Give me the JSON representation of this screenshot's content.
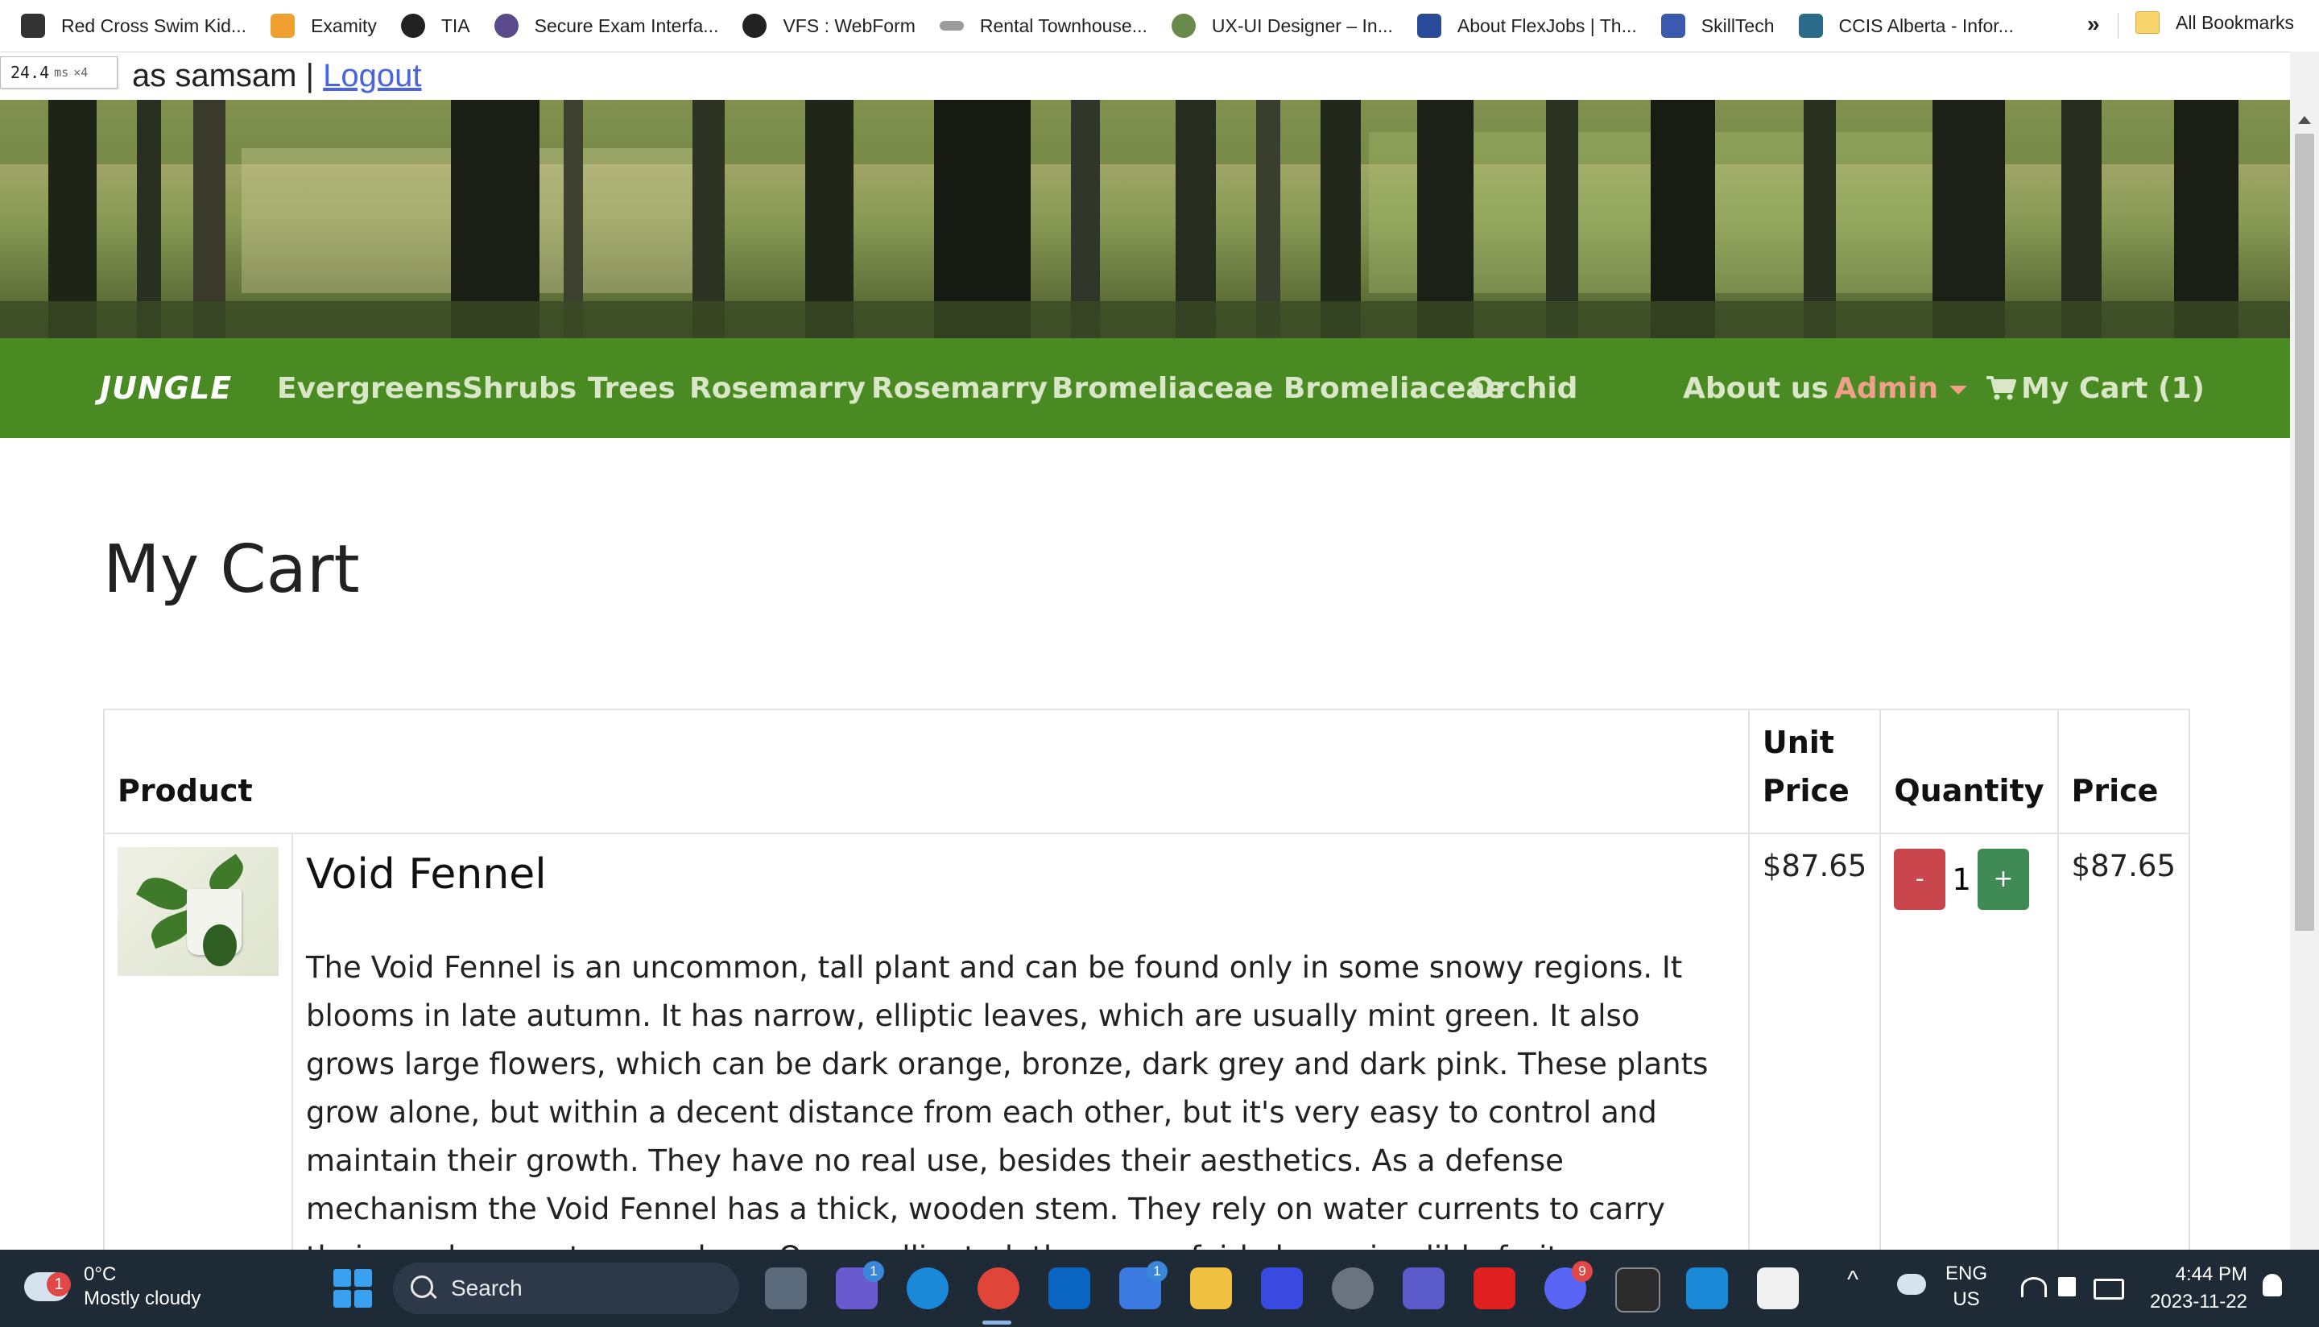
{
  "bookmarks": {
    "items": [
      {
        "label": "Red Cross Swim Kid...",
        "color": "#333333"
      },
      {
        "label": "Examity",
        "color": "#f0a030"
      },
      {
        "label": "TIA",
        "color": "#222222"
      },
      {
        "label": "Secure Exam Interfa...",
        "color": "#5a4a8a"
      },
      {
        "label": "VFS : WebForm",
        "color": "#222222"
      },
      {
        "label": "Rental Townhouse...",
        "color": "#9a9a9a"
      },
      {
        "label": "UX-UI Designer – In...",
        "color": "#6a8a4a"
      },
      {
        "label": "About FlexJobs | Th...",
        "color": "#2a4a9a"
      },
      {
        "label": "SkillTech",
        "color": "#3a5ab0"
      },
      {
        "label": "CCIS Alberta - Infor...",
        "color": "#2a6a8a"
      }
    ],
    "more": "»",
    "all": "All Bookmarks"
  },
  "perf": {
    "value": "24.4",
    "unit": "ms",
    "mult": "×4"
  },
  "login": {
    "text": "as samsam",
    "separator": "|",
    "logout": "Logout"
  },
  "navbar": {
    "brand": "JUNGLE",
    "links": [
      "Evergreens",
      "Shrubs",
      "Trees",
      "Rosemarry",
      "Rosemarry",
      "Bromeliaceae Bromeliaceae",
      "Orchid"
    ],
    "about": "About us",
    "admin": "Admin",
    "cart": "My Cart (1)",
    "bg_color": "#4a8a22",
    "admin_color": "#f0a08a"
  },
  "page": {
    "title": "My Cart"
  },
  "table": {
    "headers": {
      "product": "Product",
      "unit_price": "Unit Price",
      "quantity": "Quantity",
      "price": "Price"
    },
    "rows": [
      {
        "name": "Void Fennel",
        "description": "The Void Fennel is an uncommon, tall plant and can be found only in some snowy regions. It blooms in late autumn. It has narrow, elliptic leaves, which are usually mint green. It also grows large flowers, which can be dark orange, bronze, dark grey and dark pink. These plants grow alone, but within a decent distance from each other, but it's very easy to control and maintain their growth. They have no real use, besides their aesthetics. As a defense mechanism the Void Fennel has a thick, wooden stem. They rely on water currents to carry their seeds away to reproduce. Once pollinated, they grow fairly large, inedible fruits.",
        "unit_price": "$87.65",
        "quantity": "1",
        "price": "$87.65",
        "minus": "-",
        "plus": "+"
      }
    ]
  },
  "taskbar": {
    "weather": {
      "temp": "0°C",
      "condition": "Mostly cloudy",
      "badge": "1"
    },
    "search": "Search",
    "badges": {
      "chat": "1",
      "store": "1",
      "discord": "9"
    },
    "lang": "ENG",
    "region": "US",
    "time": "4:44 PM",
    "date": "2023-11-22"
  }
}
